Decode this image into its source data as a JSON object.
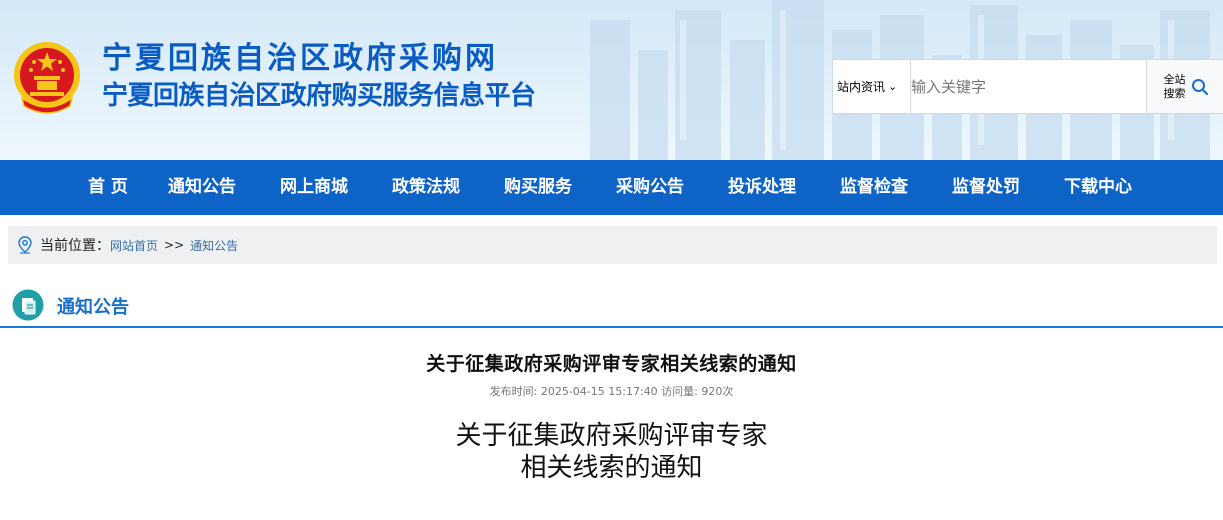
{
  "header": {
    "title": "宁夏回族自治区政府采购网",
    "subtitle": "宁夏回族自治区政府购买服务信息平台"
  },
  "search": {
    "scope_selected": "站内资讯",
    "placeholder": "输入关键字",
    "button_line1": "全站",
    "button_line2": "搜索"
  },
  "nav": {
    "items": [
      "首 页",
      "通知公告",
      "网上商城",
      "政策法规",
      "购买服务",
      "采购公告",
      "投诉处理",
      "监督检查",
      "监督处罚",
      "下载中心"
    ]
  },
  "breadcrumb": {
    "label": "当前位置：",
    "home": "网站首页",
    "separator": ">>",
    "current": "通知公告"
  },
  "section": {
    "title": "通知公告"
  },
  "article": {
    "title": "关于征集政府采购评审专家相关线索的通知",
    "meta": "发布时间: 2025-04-15 15:17:40 访问量: 920次",
    "heading_line1": "关于征集政府采购评审专家",
    "heading_line2": "相关线索的通知"
  },
  "colors": {
    "brand_blue": "#0e63c6",
    "title_blue": "#0a5cc3",
    "emblem_red": "#d7191f",
    "emblem_gold": "#f5c518"
  },
  "icons": [
    "emblem-icon",
    "chevron-down-icon",
    "search-icon",
    "location-pin-icon",
    "document-icon"
  ]
}
